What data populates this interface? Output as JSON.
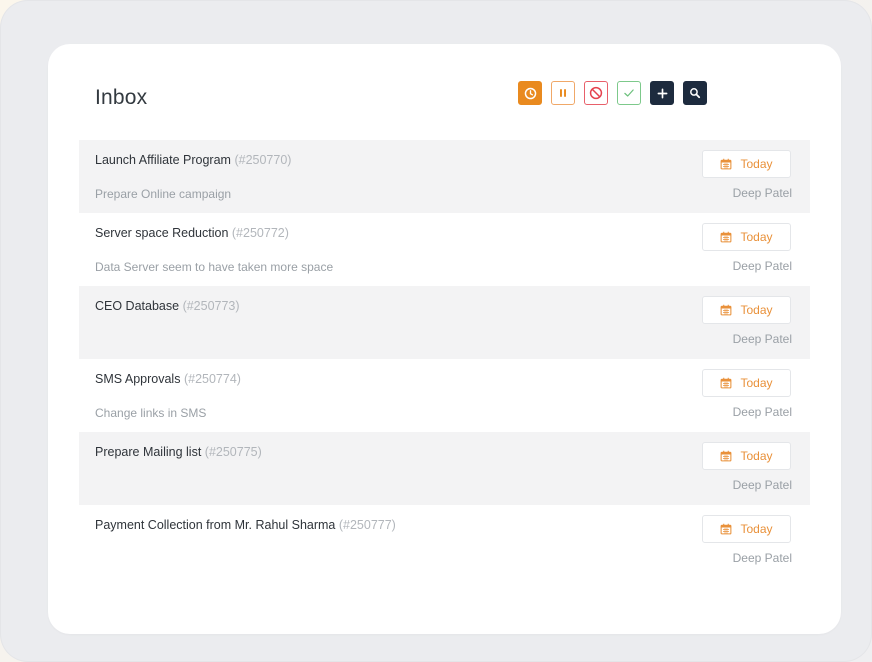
{
  "colors": {
    "accent_orange": "#e98a1f",
    "pause_orange": "#f0a868",
    "cancel_red": "#e8606a",
    "done_green": "#7dc98b",
    "navy": "#1d2b3e",
    "badge_text": "#e9913a"
  },
  "header": {
    "title": "Inbox",
    "toolbar": [
      {
        "name": "clock-icon"
      },
      {
        "name": "pause-icon"
      },
      {
        "name": "block-icon"
      },
      {
        "name": "check-icon"
      },
      {
        "name": "plus-icon"
      },
      {
        "name": "search-icon"
      }
    ]
  },
  "tasks": [
    {
      "title": "Launch Affiliate Program",
      "id": "(#250770)",
      "description": "Prepare Online campaign",
      "due": "Today",
      "assignee": "Deep Patel"
    },
    {
      "title": "Server space Reduction",
      "id": "(#250772)",
      "description": "Data Server seem to have taken more space",
      "due": "Today",
      "assignee": "Deep Patel"
    },
    {
      "title": "CEO Database",
      "id": "(#250773)",
      "description": "",
      "due": "Today",
      "assignee": "Deep Patel"
    },
    {
      "title": "SMS Approvals",
      "id": "(#250774)",
      "description": "Change links in SMS",
      "due": "Today",
      "assignee": "Deep Patel"
    },
    {
      "title": "Prepare Mailing list",
      "id": "(#250775)",
      "description": "",
      "due": "Today",
      "assignee": "Deep Patel"
    },
    {
      "title": "Payment Collection from Mr. Rahul Sharma",
      "id": "(#250777)",
      "description": "",
      "due": "Today",
      "assignee": "Deep Patel"
    }
  ]
}
